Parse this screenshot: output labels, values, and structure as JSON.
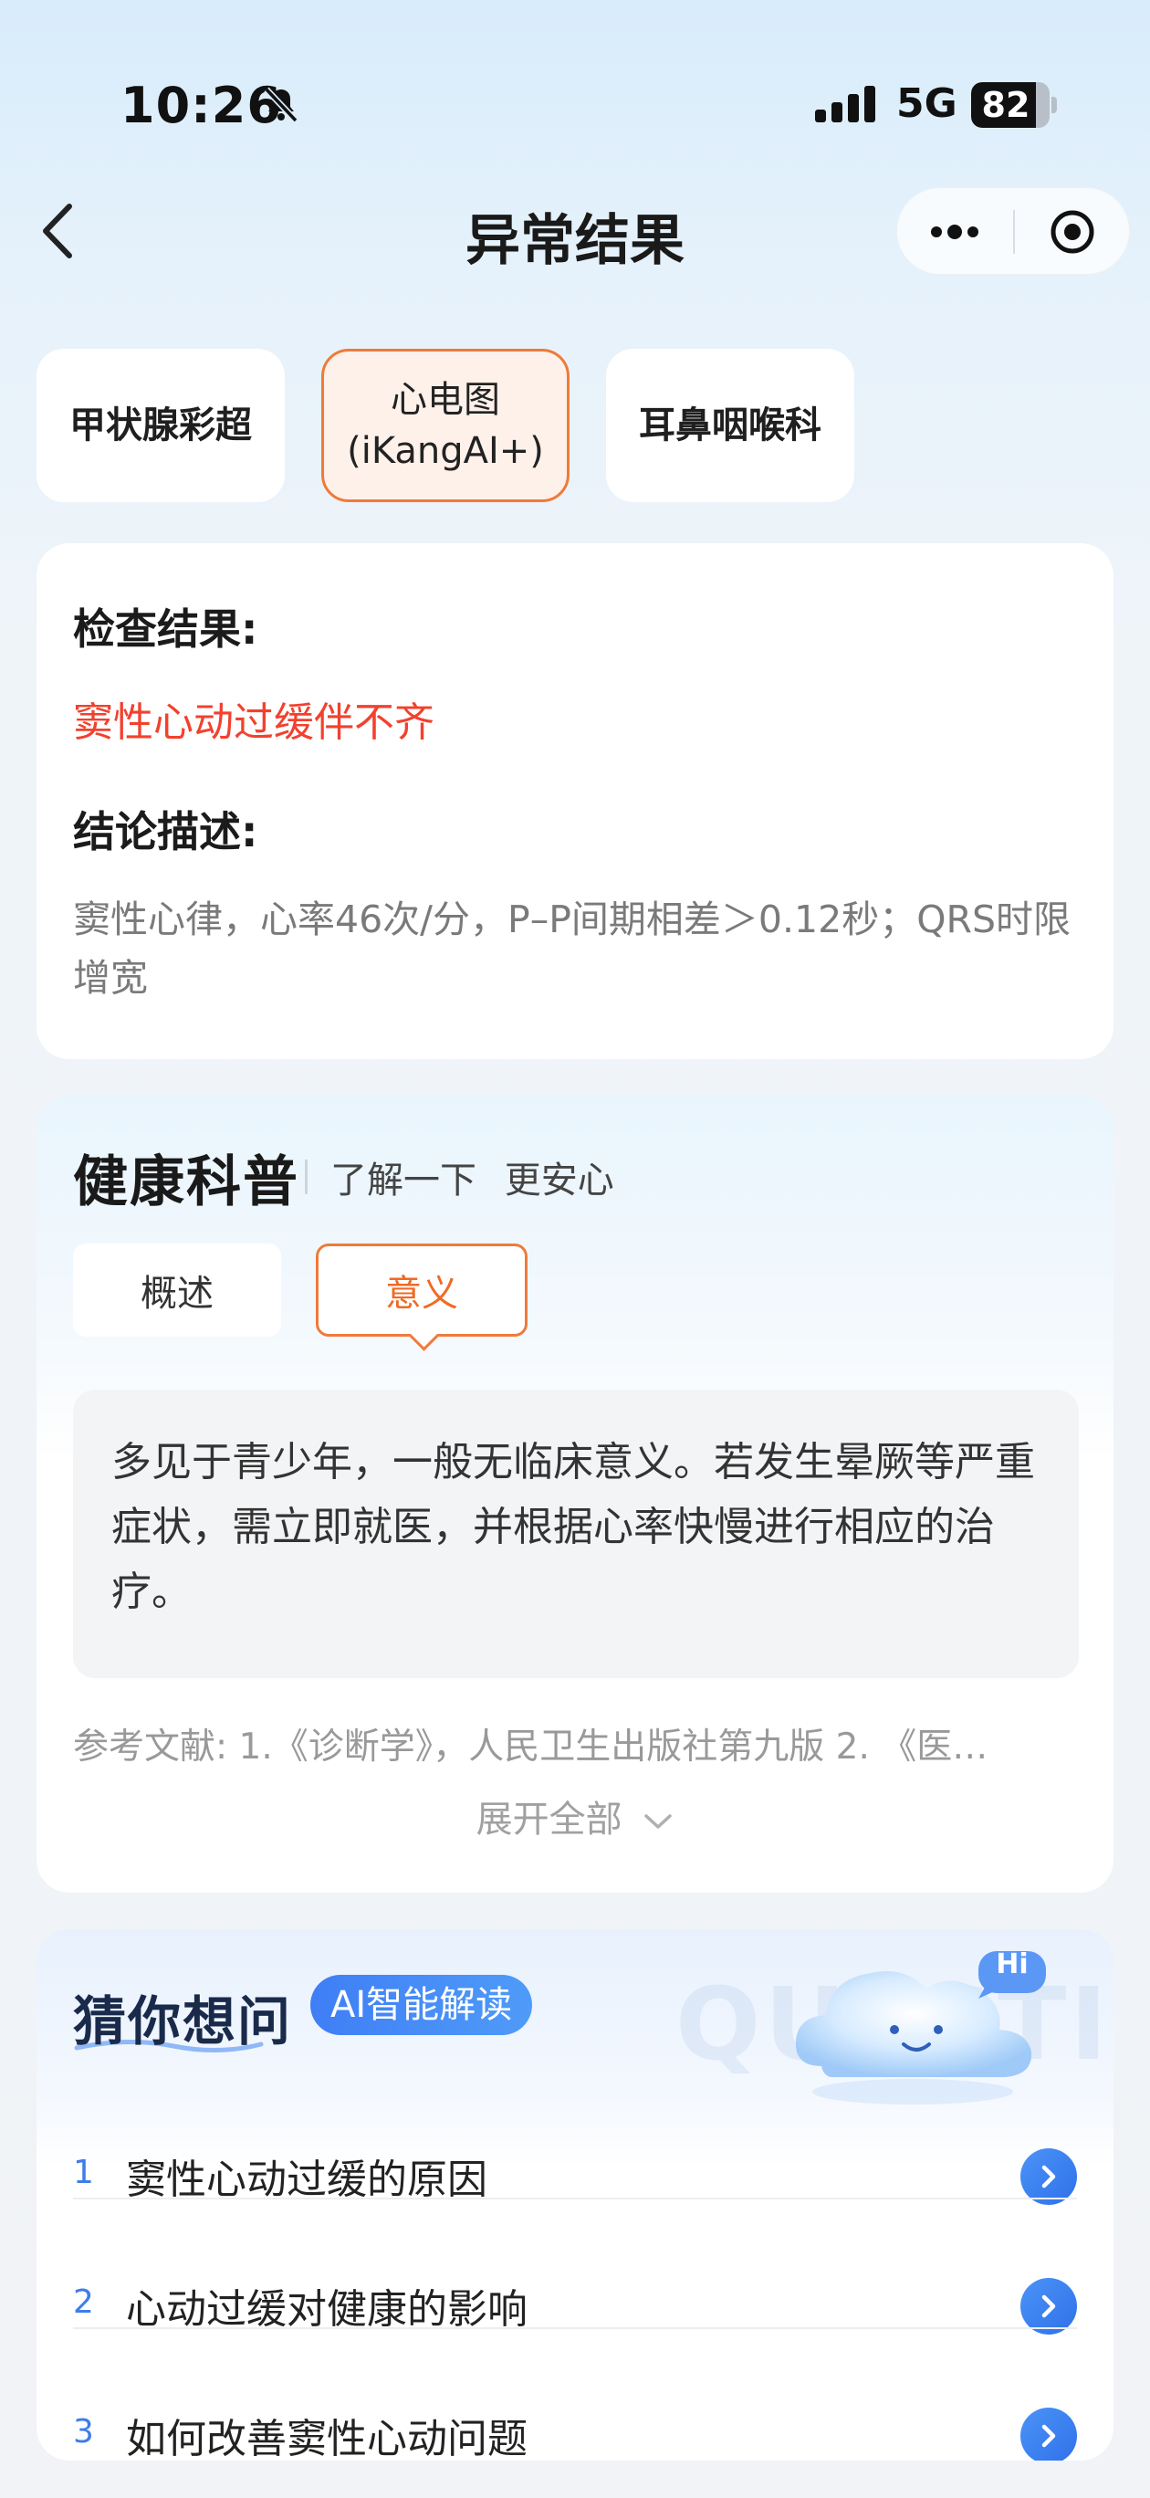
{
  "status_bar": {
    "time": "10:26",
    "network": "5G",
    "battery_level": "82",
    "battery_fraction": 0.82
  },
  "nav": {
    "title": "异常结果"
  },
  "exam_tabs": [
    {
      "label": "甲状腺彩超",
      "active": false
    },
    {
      "label": "心电图\n(iKangAI+)",
      "active": true
    },
    {
      "label": "耳鼻咽喉科",
      "active": false
    }
  ],
  "result": {
    "result_label": "检查结果:",
    "result_value": "窦性心动过缓伴不齐",
    "conclusion_label": "结论描述:",
    "conclusion_value": "窦性心律，心率46次/分，P–P间期相差＞0.12秒；QRS时限增宽"
  },
  "health": {
    "title": "健康科普",
    "subtitle": "了解一下 更安心",
    "tabs": [
      {
        "label": "概述",
        "active": false
      },
      {
        "label": "意义",
        "active": true
      }
    ],
    "content": "多见于青少年，一般无临床意义。若发生晕厥等严重症状，需立即就医，并根据心率快慢进行相应的治疗。",
    "references": "参考文献: 1.《诊断学》，人民卫生出版社第九版 2. 《医…",
    "expand_label": "展开全部"
  },
  "guess": {
    "title": "猜你想问",
    "badge": "AI智能解读",
    "watermark": "QUESTION",
    "mascot_label": "Hi",
    "questions": [
      {
        "num": "1",
        "text": "窦性心动过缓的原因"
      },
      {
        "num": "2",
        "text": "心动过缓对健康的影响"
      },
      {
        "num": "3",
        "text": "如何改善窦性心动问题"
      }
    ]
  },
  "colors": {
    "accent_orange": "#f07a3a",
    "alert_red": "#f2412e",
    "ai_blue": "#3f7ef6"
  }
}
